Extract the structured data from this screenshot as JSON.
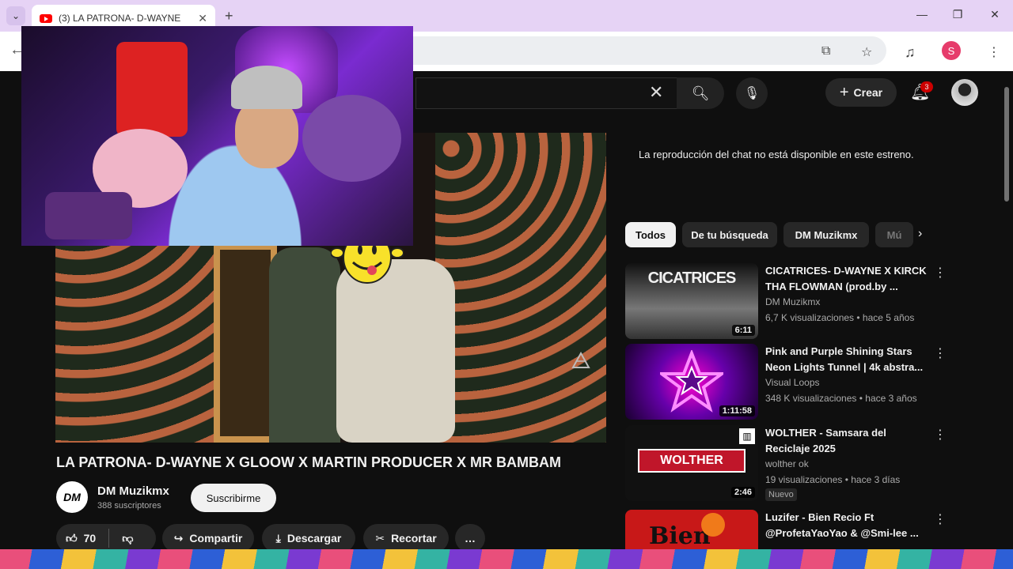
{
  "browser": {
    "tab_title": "(3) LA PATRONA- D-WAYNE",
    "profile_initial": "S"
  },
  "header": {
    "create_label": "Crear",
    "notifications": "3"
  },
  "video": {
    "title": "LA PATRONA- D-WAYNE X GLOOW X MARTIN PRODUCER X MR BAMBAM",
    "channel_logo": "DM",
    "channel_name": "DM Muzikmx",
    "subscribers": "388 suscriptores",
    "subscribe_label": "Suscribirme",
    "likes": "70",
    "share_label": "Compartir",
    "download_label": "Descargar",
    "clip_label": "Recortar",
    "more_label": "…"
  },
  "chat": {
    "message": "La reproducción del chat no está disponible en este estreno."
  },
  "chips": [
    "Todos",
    "De tu búsqueda",
    "DM Muzikmx",
    "Mú"
  ],
  "suggestions": [
    {
      "title": "CICATRICES- D-WAYNE X KIRCK THA FLOWMAN (prod.by ...",
      "channel": "DM Muzikmx",
      "meta": "6,7 K visualizaciones • hace 5 años",
      "duration": "6:11",
      "thumb_text": "CICATRICES"
    },
    {
      "title": "Pink and Purple Shining Stars Neon Lights Tunnel | 4k abstra...",
      "channel": "Visual Loops",
      "meta": "348 K visualizaciones • hace 3 años",
      "duration": "1:11:58"
    },
    {
      "title": "WOLTHER - Samsara del Reciclaje 2025",
      "channel": "wolther ok",
      "meta": "19 visualizaciones • hace 3 días",
      "duration": "2:46",
      "badge": "Nuevo",
      "thumb_text": "WOLTHER"
    },
    {
      "title": "Luzifer - Bien Recio Ft @ProfetaYaoYao & @Smi-lee ...",
      "channel": "",
      "meta": "",
      "duration": "",
      "thumb_text": "Bien"
    }
  ],
  "colors": {
    "background": "#0f0f0f",
    "accent_red": "#cc0000",
    "chip_bg": "#272727",
    "tabbar": "#e6d3f5"
  }
}
